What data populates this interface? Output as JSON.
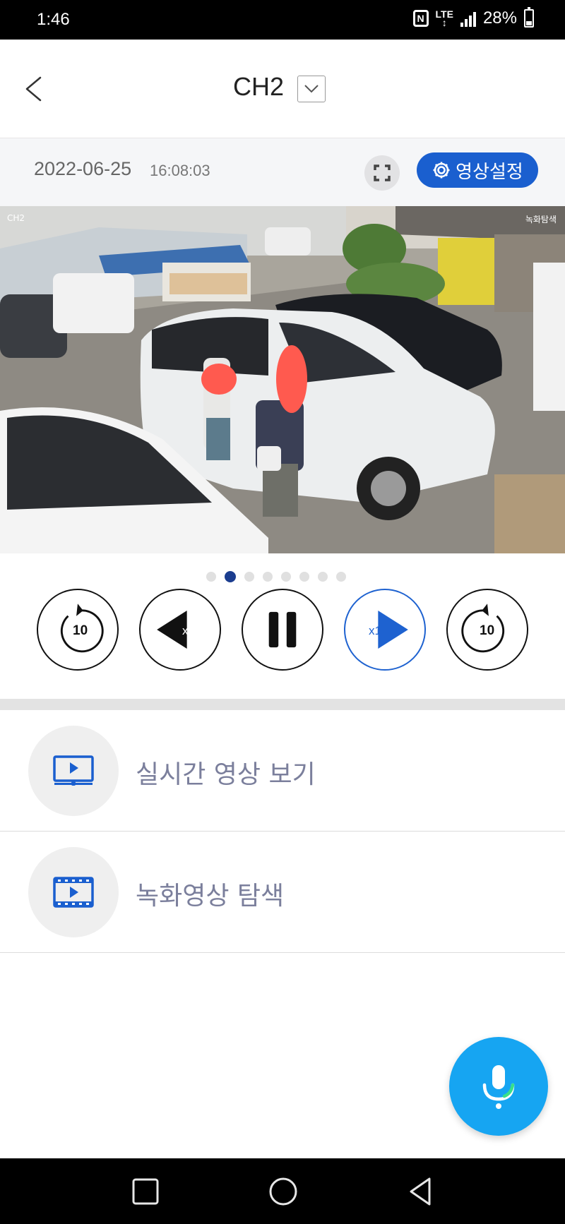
{
  "status_bar": {
    "time": "1:46",
    "nfc": "N",
    "network": "LTE",
    "battery": "28%",
    "icons": [
      "nfc-icon",
      "lte-icon",
      "signal-icon",
      "battery-icon"
    ]
  },
  "header": {
    "title": "CH2",
    "back_icon": "chevron-left-icon",
    "dropdown_icon": "chevron-down-icon"
  },
  "playback_info": {
    "date": "2022-06-25",
    "time": "16:08:03",
    "fullscreen_icon": "fullscreen-icon",
    "settings_label": "영상설정",
    "settings_icon": "gear-icon"
  },
  "video": {
    "osd_channel": "CH2",
    "osd_label": "녹화탐색"
  },
  "pager": {
    "total": 8,
    "active_index": 1
  },
  "controls": {
    "rewind_seconds": "10",
    "reverse_speed": "x1",
    "forward_speed": "x1",
    "forward_seconds": "10",
    "icons": [
      "rewind-10-icon",
      "reverse-play-icon",
      "pause-icon",
      "play-icon",
      "forward-10-icon"
    ],
    "accent_color": "#1e62d0"
  },
  "menu": {
    "items": [
      {
        "label": "실시간 영상 보기",
        "icon": "live-video-icon"
      },
      {
        "label": "녹화영상 탐색",
        "icon": "recorded-video-icon"
      }
    ],
    "icon_color": "#1a5fcf",
    "label_color": "#7b7f9c"
  },
  "fab": {
    "icon": "microphone-icon",
    "color": "#16a5f2"
  },
  "nav_bar": {
    "icons": [
      "recents-icon",
      "home-icon",
      "back-icon"
    ]
  }
}
